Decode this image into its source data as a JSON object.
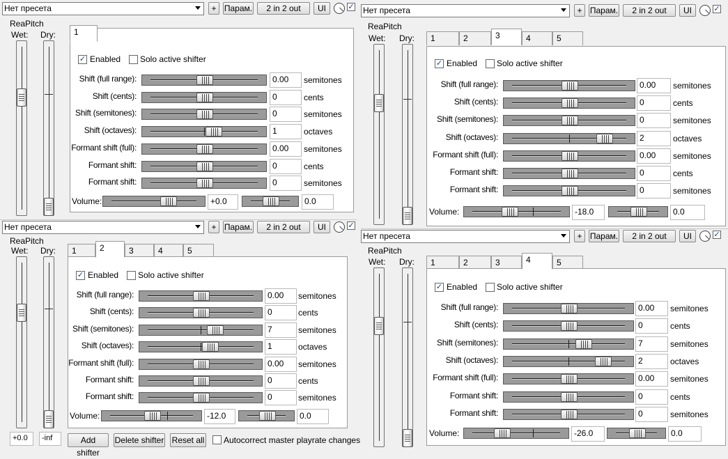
{
  "common": {
    "preset": "Нет пресета",
    "plus": "+",
    "params": "Парам.",
    "io": "2 in 2 out",
    "ui": "UI",
    "check_mark": "✓",
    "plugin_name": "ReaPitch",
    "wet": "Wet:",
    "dry": "Dry:",
    "enabled": "Enabled",
    "solo": "Solo active shifter",
    "volume": "Volume:",
    "tabs": [
      "1",
      "2",
      "3",
      "4",
      "5"
    ],
    "rows": [
      {
        "label": "Shift (full range):",
        "unit": "semitones"
      },
      {
        "label": "Shift (cents):",
        "unit": "cents"
      },
      {
        "label": "Shift (semitones):",
        "unit": "semitones"
      },
      {
        "label": "Shift (octaves):",
        "unit": "octaves"
      },
      {
        "label": "Formant shift (full):",
        "unit": "semitones"
      },
      {
        "label": "Formant shift:",
        "unit": "cents"
      },
      {
        "label": "Formant shift:",
        "unit": "semitones"
      }
    ],
    "colors": {
      "slider_bg": "#9a9a9a",
      "check": "#1b3e8f",
      "panel": "#ffffff",
      "window": "#f0f0f0"
    }
  },
  "windows": [
    {
      "id": "w1",
      "active_tab": "1",
      "values": [
        "0.00",
        "0",
        "0",
        "1",
        "0.00",
        "0",
        "0"
      ],
      "volume": "+0.0",
      "pan": "0.0",
      "levels": {
        "wet": 0.7,
        "dry": 0.0
      },
      "slider_pos": [
        0.5,
        0.5,
        0.5,
        0.6,
        0.5,
        0.5,
        0.5
      ],
      "vol_pos": 0.7,
      "pan_pos": 0.5
    },
    {
      "id": "w2",
      "active_tab": "2",
      "values": [
        "0.00",
        "0",
        "7",
        "1",
        "0.00",
        "0",
        "0"
      ],
      "volume": "-12.0",
      "pan": "0.0",
      "levels": {
        "wet": 0.7,
        "dry": 0.0
      },
      "slider_pos": [
        0.5,
        0.5,
        0.65,
        0.6,
        0.5,
        0.5,
        0.5
      ],
      "vol_pos": 0.5,
      "pan_pos": 0.5,
      "wet_readout": "+0.0",
      "dry_readout": "-inf",
      "footer": {
        "add": "Add shifter",
        "delete": "Delete shifter",
        "reset": "Reset all",
        "autocorrect": "Autocorrect master playrate changes"
      }
    },
    {
      "id": "w3",
      "active_tab": "3",
      "values": [
        "0.00",
        "0",
        "0",
        "2",
        "0.00",
        "0",
        "0"
      ],
      "volume": "-18.0",
      "pan": "0.0",
      "levels": {
        "wet": 0.7,
        "dry": 0.0
      },
      "slider_pos": [
        0.5,
        0.5,
        0.5,
        0.85,
        0.5,
        0.5,
        0.5
      ],
      "vol_pos": 0.4,
      "pan_pos": 0.5
    },
    {
      "id": "w4",
      "active_tab": "4",
      "values": [
        "0.00",
        "0",
        "7",
        "2",
        "0.00",
        "0",
        "0"
      ],
      "volume": "-26.0",
      "pan": "0.0",
      "levels": {
        "wet": 0.7,
        "dry": 0.0
      },
      "slider_pos": [
        0.5,
        0.5,
        0.65,
        0.85,
        0.5,
        0.5,
        0.5
      ],
      "vol_pos": 0.3,
      "pan_pos": 0.5
    }
  ]
}
